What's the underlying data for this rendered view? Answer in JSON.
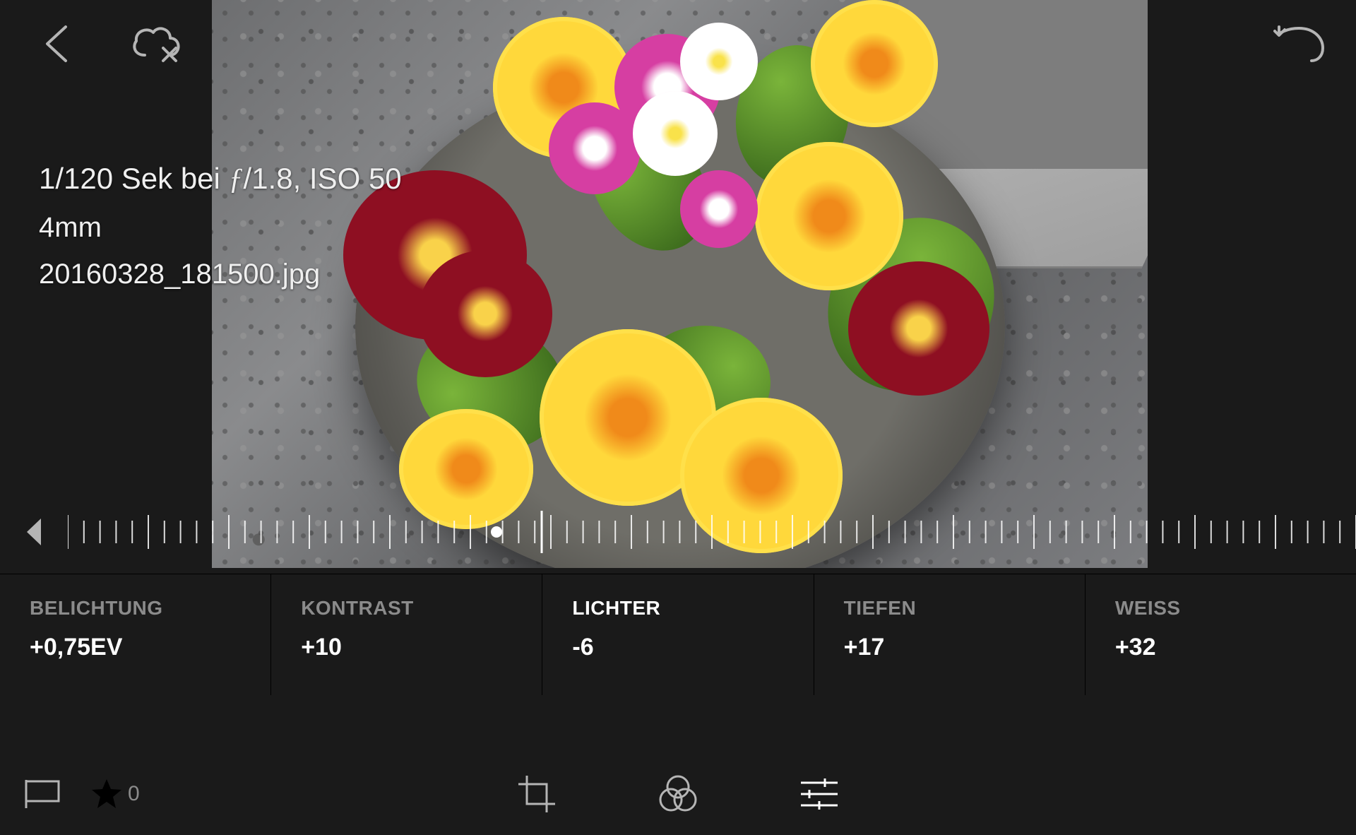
{
  "meta": {
    "exposure_prefix": "1/120 Sek bei ",
    "f_glyph": "ƒ",
    "exposure_suffix": "/1.8, ISO 50",
    "focal": "4mm",
    "filename": "20160328_181500.jpg"
  },
  "params": [
    {
      "label": "BELICHTUNG",
      "value": "+0,75EV",
      "active": false
    },
    {
      "label": "KONTRAST",
      "value": "+10",
      "active": false
    },
    {
      "label": "LICHTER",
      "value": "-6",
      "active": true
    },
    {
      "label": "TIEFEN",
      "value": "+17",
      "active": false
    },
    {
      "label": "WEISS",
      "value": "+32",
      "active": false
    }
  ],
  "star_count": "0",
  "icons": {
    "back": "back-icon",
    "cloud_reject": "cloud-reject-icon",
    "undo": "undo-icon",
    "ruler_left": "triangle-left-icon",
    "flag": "flag-icon",
    "star": "star-icon",
    "crop": "crop-icon",
    "filters": "filters-icon",
    "adjust": "adjust-sliders-icon"
  }
}
